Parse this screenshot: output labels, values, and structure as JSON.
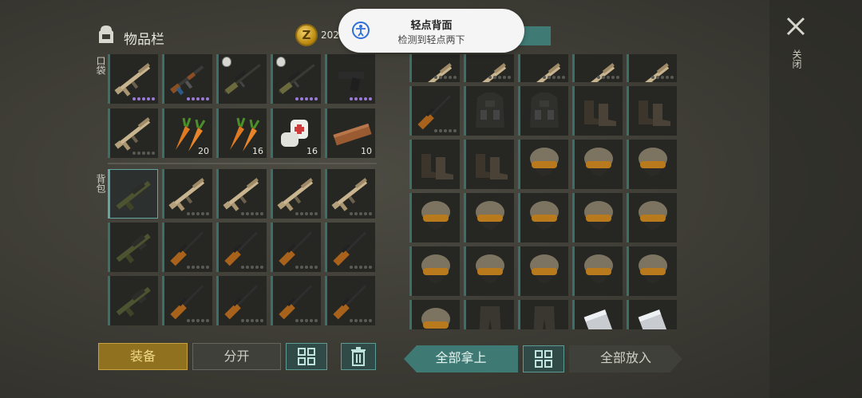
{
  "header": {
    "title": "物品栏",
    "coin_value": "202",
    "coin_symbol": "Z"
  },
  "sections": {
    "pocket_label": "口袋",
    "backpack_label": "背包"
  },
  "pocket": [
    {
      "item": "assault-rifle-tan",
      "dots": "purple"
    },
    {
      "item": "ak-rifle",
      "dots": "purple"
    },
    {
      "item": "sniper-rifle",
      "badge": true
    },
    {
      "item": "sniper-rifle",
      "badge": true,
      "dots": "purple"
    },
    {
      "item": "pistol",
      "dots": "purple"
    },
    {
      "item": "assault-rifle-tan",
      "dots": "grey"
    },
    {
      "item": "carrot",
      "count": "20"
    },
    {
      "item": "carrot",
      "count": "16"
    },
    {
      "item": "bandage",
      "count": "16"
    },
    {
      "item": "plank",
      "count": "10"
    }
  ],
  "backpack": [
    {
      "item": "grenade-launcher",
      "selected": true
    },
    {
      "item": "assault-rifle-tan",
      "dots": "grey"
    },
    {
      "item": "assault-rifle-tan",
      "dots": "grey"
    },
    {
      "item": "assault-rifle-tan",
      "dots": "grey"
    },
    {
      "item": "assault-rifle-tan",
      "dots": "grey"
    },
    {
      "item": "grenade-launcher"
    },
    {
      "item": "wood-rifle",
      "dots": "grey"
    },
    {
      "item": "wood-rifle",
      "dots": "grey"
    },
    {
      "item": "wood-rifle",
      "dots": "grey"
    },
    {
      "item": "wood-rifle",
      "dots": "grey"
    },
    {
      "item": "grenade-launcher"
    },
    {
      "item": "wood-rifle",
      "dots": "grey"
    },
    {
      "item": "wood-rifle",
      "dots": "grey"
    },
    {
      "item": "wood-rifle",
      "dots": "grey"
    },
    {
      "item": "wood-rifle",
      "dots": "grey"
    }
  ],
  "loot": [
    {
      "item": "assault-rifle-tan",
      "dots": "grey"
    },
    {
      "item": "assault-rifle-tan",
      "dots": "grey"
    },
    {
      "item": "assault-rifle-tan",
      "dots": "grey"
    },
    {
      "item": "assault-rifle-tan",
      "dots": "grey"
    },
    {
      "item": "assault-rifle-tan",
      "dots": "grey"
    },
    {
      "item": "wood-rifle",
      "dots": "grey"
    },
    {
      "item": "tactical-vest"
    },
    {
      "item": "tactical-vest"
    },
    {
      "item": "boots"
    },
    {
      "item": "boots"
    },
    {
      "item": "boots"
    },
    {
      "item": "boots"
    },
    {
      "item": "helmet"
    },
    {
      "item": "helmet"
    },
    {
      "item": "helmet"
    },
    {
      "item": "helmet"
    },
    {
      "item": "helmet"
    },
    {
      "item": "helmet"
    },
    {
      "item": "helmet"
    },
    {
      "item": "helmet"
    },
    {
      "item": "helmet"
    },
    {
      "item": "helmet"
    },
    {
      "item": "helmet"
    },
    {
      "item": "helmet"
    },
    {
      "item": "helmet"
    },
    {
      "item": "helmet"
    },
    {
      "item": "pants"
    },
    {
      "item": "pants"
    },
    {
      "item": "metal-sheet"
    },
    {
      "item": "metal-sheet"
    }
  ],
  "buttons": {
    "equip": "装备",
    "split": "分开",
    "take_all": "全部拿上",
    "put_all": "全部放入",
    "close": "关闭"
  },
  "toast": {
    "title": "轻点背面",
    "subtitle": "检测到轻点两下"
  },
  "colors": {
    "accent_teal": "#3e7974",
    "equip_gold": "#8f7120",
    "rarity_purple": "#9b7bd8"
  }
}
